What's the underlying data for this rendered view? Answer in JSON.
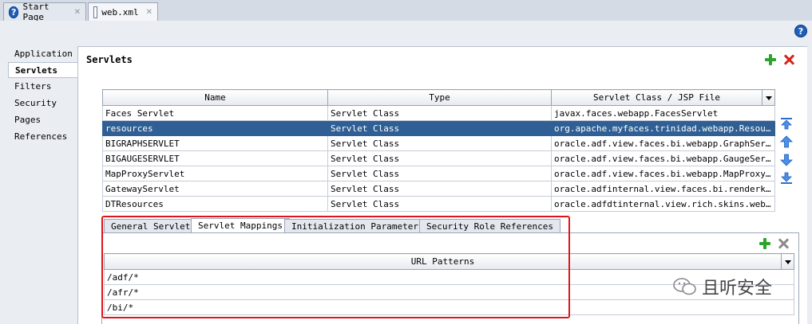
{
  "tabs": [
    {
      "label": "Start Page",
      "active": false
    },
    {
      "label": "web.xml",
      "active": true
    }
  ],
  "nav": {
    "items": [
      "Application",
      "Servlets",
      "Filters",
      "Security",
      "Pages",
      "References"
    ],
    "selected": "Servlets"
  },
  "section": {
    "title": "Servlets"
  },
  "servlets_table": {
    "columns": [
      "Name",
      "Type",
      "Servlet Class / JSP File"
    ],
    "rows": [
      [
        "Faces Servlet",
        "Servlet Class",
        "javax.faces.webapp.FacesServlet"
      ],
      [
        "resources",
        "Servlet Class",
        "org.apache.myfaces.trinidad.webapp.Resource..."
      ],
      [
        "BIGRAPHSERVLET",
        "Servlet Class",
        "oracle.adf.view.faces.bi.webapp.GraphServlet"
      ],
      [
        "BIGAUGESERVLET",
        "Servlet Class",
        "oracle.adf.view.faces.bi.webapp.GaugeServlet"
      ],
      [
        "MapProxyServlet",
        "Servlet Class",
        "oracle.adf.view.faces.bi.webapp.MapProxySer..."
      ],
      [
        "GatewayServlet",
        "Servlet Class",
        "oracle.adfinternal.view.faces.bi.renderkit...."
      ],
      [
        "DTResources",
        "Servlet Class",
        "oracle.adfdtinternal.view.rich.skins.webapp...."
      ]
    ],
    "selected_row": 1
  },
  "detail_tabs": [
    "General Servlet",
    "Servlet Mappings",
    "Initialization Parameters",
    "Security Role References"
  ],
  "detail_tab_active": "Servlet Mappings",
  "url_table": {
    "column": "URL Patterns",
    "rows": [
      "/adf/*",
      "/afr/*",
      "/bi/*"
    ]
  },
  "watermark": {
    "text": "且听安全"
  },
  "colors": {
    "selection": "#2f5f94",
    "highlight_box": "#e0151b",
    "add": "#2ea32a",
    "delete": "#d8221a"
  }
}
